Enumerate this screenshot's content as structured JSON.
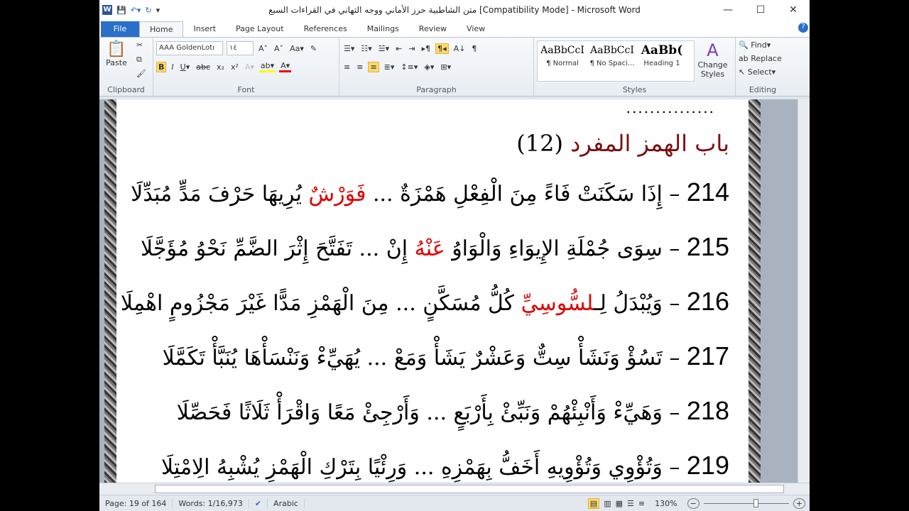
{
  "title": "متن الشاطبية حرز الأماني ووجه التهاني في القراءات السبع [Compatibility Mode] - Microsoft Word",
  "tabs": [
    "File",
    "Home",
    "Insert",
    "Page Layout",
    "References",
    "Mailings",
    "Review",
    "View"
  ],
  "clipboard": {
    "paste": "Paste",
    "label": "Clipboard"
  },
  "font": {
    "name": "AAA GoldenLotı",
    "size": "١٤",
    "label": "Font"
  },
  "paragraph": {
    "label": "Paragraph"
  },
  "styles": {
    "items": [
      {
        "sample": "AaBbCcI",
        "name": "¶ Normal"
      },
      {
        "sample": "AaBbCcI",
        "name": "¶ No Spaci..."
      },
      {
        "sample": "AaBb(",
        "name": "Heading 1"
      }
    ],
    "change": "Change Styles",
    "label": "Styles"
  },
  "editing": {
    "find": "Find",
    "replace": "Replace",
    "select": "Select",
    "label": "Editing"
  },
  "document": {
    "dots": "...............",
    "heading": "باب الهمز المفرد",
    "heading_num": "(12)",
    "verses": [
      {
        "n": "214",
        "parts": [
          "إِذَا سَكَنَتْ فَاءً مِنَ الْفِعْلِ هَمْزَةٌ ... ",
          "فَوَرْشٌ",
          " يُرِيهَا حَرْفَ مَدٍّ مُبَدِّلَا"
        ]
      },
      {
        "n": "215",
        "parts": [
          "سِوَى جُمْلَةِ الإِيوَاءِ وَالْوَاوُ ",
          "عَنْهُ",
          " إِنْ ... تَفَتَّحَ إِثْرَ الضَّمِّ نَحْوُ مُؤَجَّلَا"
        ]
      },
      {
        "n": "216",
        "parts": [
          "وَيُبْدَلُ لِـ",
          "لسُّوسِيِّ",
          " كُلُّ مُسَكَّنٍ ... مِنَ الْهَمْزِ مَدًّا غَيْرَ مَجْزُومٍ اهْمِلَا"
        ]
      },
      {
        "n": "217",
        "parts": [
          "تَسُؤْ وَنَشَأْ سِتٌّ وَعَشْرٌ يَشَأْ وَمَعْ ... يُهَيِّءْ وَنَنْسَأْهَا يُنَبَّأْ تَكَمَّلَا",
          "",
          ""
        ]
      },
      {
        "n": "218",
        "parts": [
          "وَهَيِّءْ وَأَنْبِئْهُمْ وَنَبِّئْ بِأَرْبَعٍ ... وَأَرْجِئْ مَعًا وَاقْرَأْ ثَلَاثًا فَحَصِّلَا",
          "",
          ""
        ]
      },
      {
        "n": "219",
        "parts": [
          "وَتُؤْوِي وَتُؤْوِيهِ أَخَفُّ بِهَمْزِهِ ... وَرِئْيًا بِتَرْكِ الْهَمْزِ يُشْبِهُ الِامْتِلَا",
          "",
          ""
        ]
      }
    ]
  },
  "status": {
    "page": "Page: 19 of 164",
    "words": "Words: 1/16,973",
    "language": "Arabic",
    "zoom": "130%"
  }
}
